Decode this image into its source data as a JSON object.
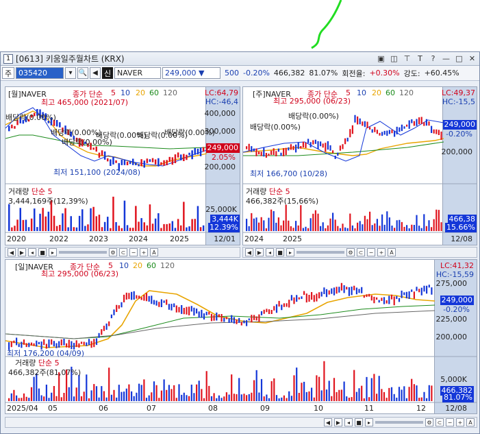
{
  "window": {
    "number": "1",
    "title": "[0613] 키움일주월차트 (KRX)",
    "icons": [
      "dock-icon",
      "window-icon",
      "pin-icon",
      "text-icon",
      "help-icon",
      "minimize-icon",
      "maximize-icon",
      "close-icon"
    ]
  },
  "toolbar": {
    "period": "주",
    "code": "035420",
    "sin": "신",
    "name": "NAVER",
    "price": "249,000",
    "change": "500",
    "change_pct": "-0.20%",
    "volume": "466,382",
    "volume_pct": "81.07%",
    "turnover_label": "회전율:",
    "turnover_value": "+0.30%",
    "strength_label": "강도:",
    "strength_value": "+60.45%"
  },
  "monthly": {
    "header": "[월]NAVER",
    "ma_label": "종가 단순",
    "ma_values": [
      "5",
      "10",
      "20",
      "60",
      "120"
    ],
    "lc": "LC:64,79",
    "hc": "HC:-46,4",
    "high": "최고 465,000 (2021/07)",
    "low": "최저 151,100 (2024/08)",
    "dividends": [
      "배당락(0.00%)",
      "배당락(0.00%)",
      "배당락(0.00%)",
      "배당락(0.00%)",
      "배당락(0.00%)",
      "배당락(0.00%)"
    ],
    "y_ticks": [
      "400,000",
      "300,000",
      "200,000"
    ],
    "price_tag": "249,000",
    "pct_tag": "2.05%",
    "vol_header": "거래량",
    "vol_ma": "단순 5",
    "vol_value": "3,444,169주(12,39%)",
    "vol_tick": "25,000K",
    "vol_tag": "3,444K",
    "vol_pct_tag": "12.39%",
    "x_labels": [
      "2020",
      "2022",
      "2023",
      "2024",
      "2025"
    ],
    "date": "12/01"
  },
  "weekly": {
    "header": "[주]NAVER",
    "ma_label": "종가 단순",
    "ma_values": [
      "5",
      "10",
      "20",
      "60",
      "120"
    ],
    "lc": "LC:49,37",
    "hc": "HC:-15,5",
    "high": "최고 295,000 (06/23)",
    "low": "최저 166,700 (10/28)",
    "dividends": [
      "배당락(0.00%)",
      "배당락(0.00%)"
    ],
    "y_ticks": [
      "250,000",
      "200,000"
    ],
    "price_tag": "249,000",
    "pct_tag": "-0.20%",
    "vol_header": "거래량",
    "vol_ma": "단순 5",
    "vol_value": "466,382주(15,66%)",
    "vol_tag": "466,38",
    "vol_pct_tag": "15.66%",
    "x_labels": [
      "2024",
      "2025"
    ],
    "date": "12/08"
  },
  "daily": {
    "header": "[일]NAVER",
    "ma_label": "종가 단순",
    "ma_values": [
      "5",
      "10",
      "20",
      "60",
      "120"
    ],
    "lc": "LC:41,32",
    "hc": "HC:-15,59",
    "high": "최고 295,000 (06/23)",
    "low": "최저 176,200 (04/09)",
    "y_ticks": [
      "275,000",
      "250,000",
      "225,000",
      "200,000"
    ],
    "price_tag": "249,000",
    "pct_tag": "-0.20%",
    "vol_header": "거래량",
    "vol_ma": "단순 5",
    "vol_value": "466,382주(81,07%)",
    "vol_tick": "5,000K",
    "vol_tag": "466,382",
    "vol_pct_tag": "81.07%",
    "x_labels": [
      "2025/04",
      "05",
      "06",
      "07",
      "08",
      "09",
      "10",
      "11",
      "12"
    ],
    "date": "12/08"
  },
  "colors": {
    "up": "#e0141e",
    "down": "#1437d8",
    "ma5": "#e0141e",
    "ma10": "#1437d8",
    "ma20": "#e8a400",
    "ma60": "#1a8a1a",
    "ma120": "#666666",
    "annotation": "#22dd22"
  }
}
